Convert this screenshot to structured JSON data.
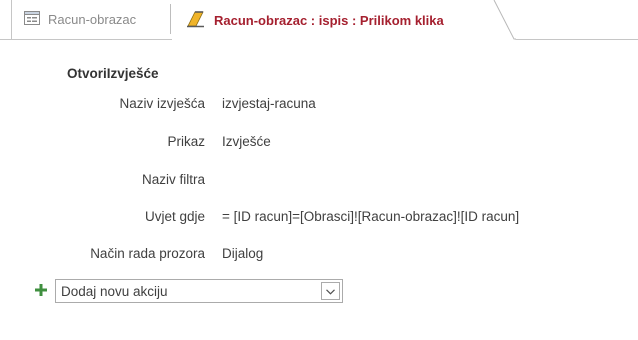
{
  "tabs": [
    {
      "label": "Racun-obrazac",
      "icon": "form-icon",
      "active": false
    },
    {
      "label": "Racun-obrazac : ispis : Prilikom klika",
      "icon": "macro-icon",
      "active": true
    }
  ],
  "macro": {
    "action_name": "OtvoriIzvješće",
    "arguments": [
      {
        "label": "Naziv izvješća",
        "value": "izvjestaj-racuna"
      },
      {
        "label": "Prikaz",
        "value": "Izvješće"
      },
      {
        "label": "Naziv filtra",
        "value": ""
      },
      {
        "label": "Uvjet gdje",
        "value": "= [ID racun]=[Obrasci]![Racun-obrazac]![ID racun]"
      },
      {
        "label": "Način rada prozora",
        "value": "Dijalog"
      }
    ]
  },
  "add_action": {
    "icon": "plus-icon",
    "combo_value": "Dodaj novu akciju",
    "dropdown_icon": "chevron-down-icon"
  },
  "colors": {
    "active_tab_text": "#a5202f",
    "inactive_tab_text": "#8a8a8a",
    "plus_green": "#3f8f3f"
  }
}
